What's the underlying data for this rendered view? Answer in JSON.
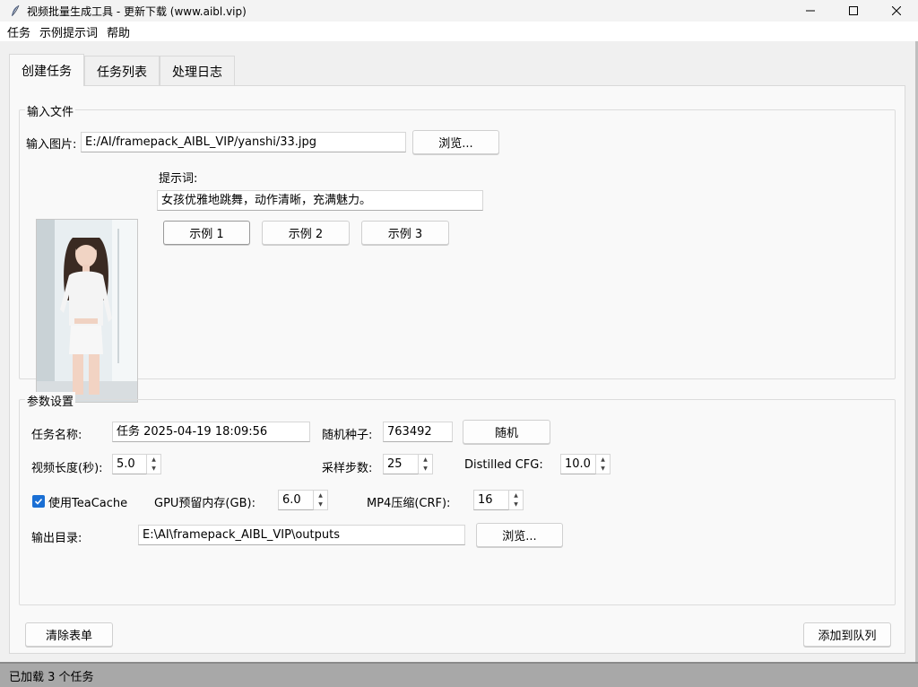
{
  "window": {
    "title": "视频批量生成工具 - 更新下载 (www.aibl.vip)",
    "minimize_glyph": "—",
    "maximize_glyph": "☐",
    "close_glyph": "✕"
  },
  "menu": [
    "任务",
    "示例提示词",
    "帮助"
  ],
  "tabs": [
    "创建任务",
    "任务列表",
    "处理日志"
  ],
  "active_tab": 0,
  "input_files": {
    "group_label": "输入文件",
    "image_label": "输入图片:",
    "image_path": "E:/AI/framepack_AIBL_VIP/yanshi/33.jpg",
    "browse_label": "浏览...",
    "prompt_label": "提示词:",
    "prompt_value": "女孩优雅地跳舞，动作清晰，充满魅力。",
    "example_buttons": [
      "示例 1",
      "示例 2",
      "示例 3"
    ]
  },
  "params": {
    "group_label": "参数设置",
    "task_name_label": "任务名称:",
    "task_name_value": "任务 2025-04-19 18:09:56",
    "seed_label": "随机种子:",
    "seed_value": "763492",
    "random_label": "随机",
    "video_length_label": "视频长度(秒):",
    "video_length_value": "5.0",
    "steps_label": "采样步数:",
    "steps_value": "25",
    "cfg_label": "Distilled CFG:",
    "cfg_value": "10.0",
    "teacache_label": "使用TeaCache",
    "teacache_checked": true,
    "gpu_label": "GPU预留内存(GB):",
    "gpu_value": "6.0",
    "crf_label": "MP4压缩(CRF):",
    "crf_value": "16",
    "output_label": "输出目录:",
    "output_value": "E:\\AI\\framepack_AIBL_VIP\\outputs",
    "output_browse_label": "浏览..."
  },
  "actions": {
    "clear_label": "清除表单",
    "add_label": "添加到队列"
  },
  "status": "已加载 3 个任务",
  "colors": {
    "accent": "#1a6fd4",
    "statusbar": "#a8a8a8"
  }
}
